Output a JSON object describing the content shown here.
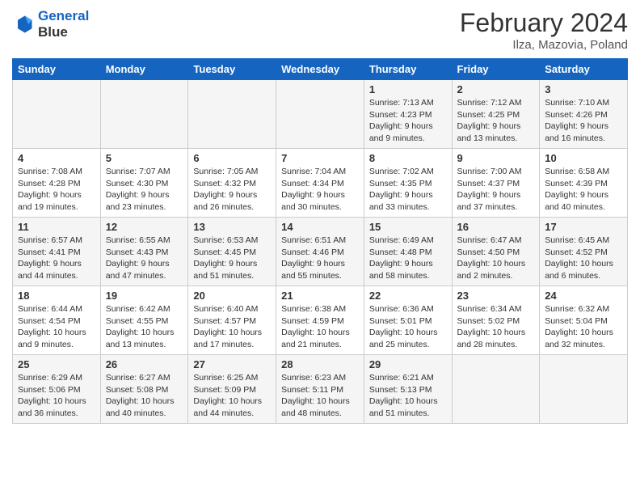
{
  "header": {
    "logo_line1": "General",
    "logo_line2": "Blue",
    "title": "February 2024",
    "subtitle": "Ilza, Mazovia, Poland"
  },
  "weekdays": [
    "Sunday",
    "Monday",
    "Tuesday",
    "Wednesday",
    "Thursday",
    "Friday",
    "Saturday"
  ],
  "weeks": [
    [
      {
        "day": "",
        "info": ""
      },
      {
        "day": "",
        "info": ""
      },
      {
        "day": "",
        "info": ""
      },
      {
        "day": "",
        "info": ""
      },
      {
        "day": "1",
        "info": "Sunrise: 7:13 AM\nSunset: 4:23 PM\nDaylight: 9 hours\nand 9 minutes."
      },
      {
        "day": "2",
        "info": "Sunrise: 7:12 AM\nSunset: 4:25 PM\nDaylight: 9 hours\nand 13 minutes."
      },
      {
        "day": "3",
        "info": "Sunrise: 7:10 AM\nSunset: 4:26 PM\nDaylight: 9 hours\nand 16 minutes."
      }
    ],
    [
      {
        "day": "4",
        "info": "Sunrise: 7:08 AM\nSunset: 4:28 PM\nDaylight: 9 hours\nand 19 minutes."
      },
      {
        "day": "5",
        "info": "Sunrise: 7:07 AM\nSunset: 4:30 PM\nDaylight: 9 hours\nand 23 minutes."
      },
      {
        "day": "6",
        "info": "Sunrise: 7:05 AM\nSunset: 4:32 PM\nDaylight: 9 hours\nand 26 minutes."
      },
      {
        "day": "7",
        "info": "Sunrise: 7:04 AM\nSunset: 4:34 PM\nDaylight: 9 hours\nand 30 minutes."
      },
      {
        "day": "8",
        "info": "Sunrise: 7:02 AM\nSunset: 4:35 PM\nDaylight: 9 hours\nand 33 minutes."
      },
      {
        "day": "9",
        "info": "Sunrise: 7:00 AM\nSunset: 4:37 PM\nDaylight: 9 hours\nand 37 minutes."
      },
      {
        "day": "10",
        "info": "Sunrise: 6:58 AM\nSunset: 4:39 PM\nDaylight: 9 hours\nand 40 minutes."
      }
    ],
    [
      {
        "day": "11",
        "info": "Sunrise: 6:57 AM\nSunset: 4:41 PM\nDaylight: 9 hours\nand 44 minutes."
      },
      {
        "day": "12",
        "info": "Sunrise: 6:55 AM\nSunset: 4:43 PM\nDaylight: 9 hours\nand 47 minutes."
      },
      {
        "day": "13",
        "info": "Sunrise: 6:53 AM\nSunset: 4:45 PM\nDaylight: 9 hours\nand 51 minutes."
      },
      {
        "day": "14",
        "info": "Sunrise: 6:51 AM\nSunset: 4:46 PM\nDaylight: 9 hours\nand 55 minutes."
      },
      {
        "day": "15",
        "info": "Sunrise: 6:49 AM\nSunset: 4:48 PM\nDaylight: 9 hours\nand 58 minutes."
      },
      {
        "day": "16",
        "info": "Sunrise: 6:47 AM\nSunset: 4:50 PM\nDaylight: 10 hours\nand 2 minutes."
      },
      {
        "day": "17",
        "info": "Sunrise: 6:45 AM\nSunset: 4:52 PM\nDaylight: 10 hours\nand 6 minutes."
      }
    ],
    [
      {
        "day": "18",
        "info": "Sunrise: 6:44 AM\nSunset: 4:54 PM\nDaylight: 10 hours\nand 9 minutes."
      },
      {
        "day": "19",
        "info": "Sunrise: 6:42 AM\nSunset: 4:55 PM\nDaylight: 10 hours\nand 13 minutes."
      },
      {
        "day": "20",
        "info": "Sunrise: 6:40 AM\nSunset: 4:57 PM\nDaylight: 10 hours\nand 17 minutes."
      },
      {
        "day": "21",
        "info": "Sunrise: 6:38 AM\nSunset: 4:59 PM\nDaylight: 10 hours\nand 21 minutes."
      },
      {
        "day": "22",
        "info": "Sunrise: 6:36 AM\nSunset: 5:01 PM\nDaylight: 10 hours\nand 25 minutes."
      },
      {
        "day": "23",
        "info": "Sunrise: 6:34 AM\nSunset: 5:02 PM\nDaylight: 10 hours\nand 28 minutes."
      },
      {
        "day": "24",
        "info": "Sunrise: 6:32 AM\nSunset: 5:04 PM\nDaylight: 10 hours\nand 32 minutes."
      }
    ],
    [
      {
        "day": "25",
        "info": "Sunrise: 6:29 AM\nSunset: 5:06 PM\nDaylight: 10 hours\nand 36 minutes."
      },
      {
        "day": "26",
        "info": "Sunrise: 6:27 AM\nSunset: 5:08 PM\nDaylight: 10 hours\nand 40 minutes."
      },
      {
        "day": "27",
        "info": "Sunrise: 6:25 AM\nSunset: 5:09 PM\nDaylight: 10 hours\nand 44 minutes."
      },
      {
        "day": "28",
        "info": "Sunrise: 6:23 AM\nSunset: 5:11 PM\nDaylight: 10 hours\nand 48 minutes."
      },
      {
        "day": "29",
        "info": "Sunrise: 6:21 AM\nSunset: 5:13 PM\nDaylight: 10 hours\nand 51 minutes."
      },
      {
        "day": "",
        "info": ""
      },
      {
        "day": "",
        "info": ""
      }
    ]
  ]
}
